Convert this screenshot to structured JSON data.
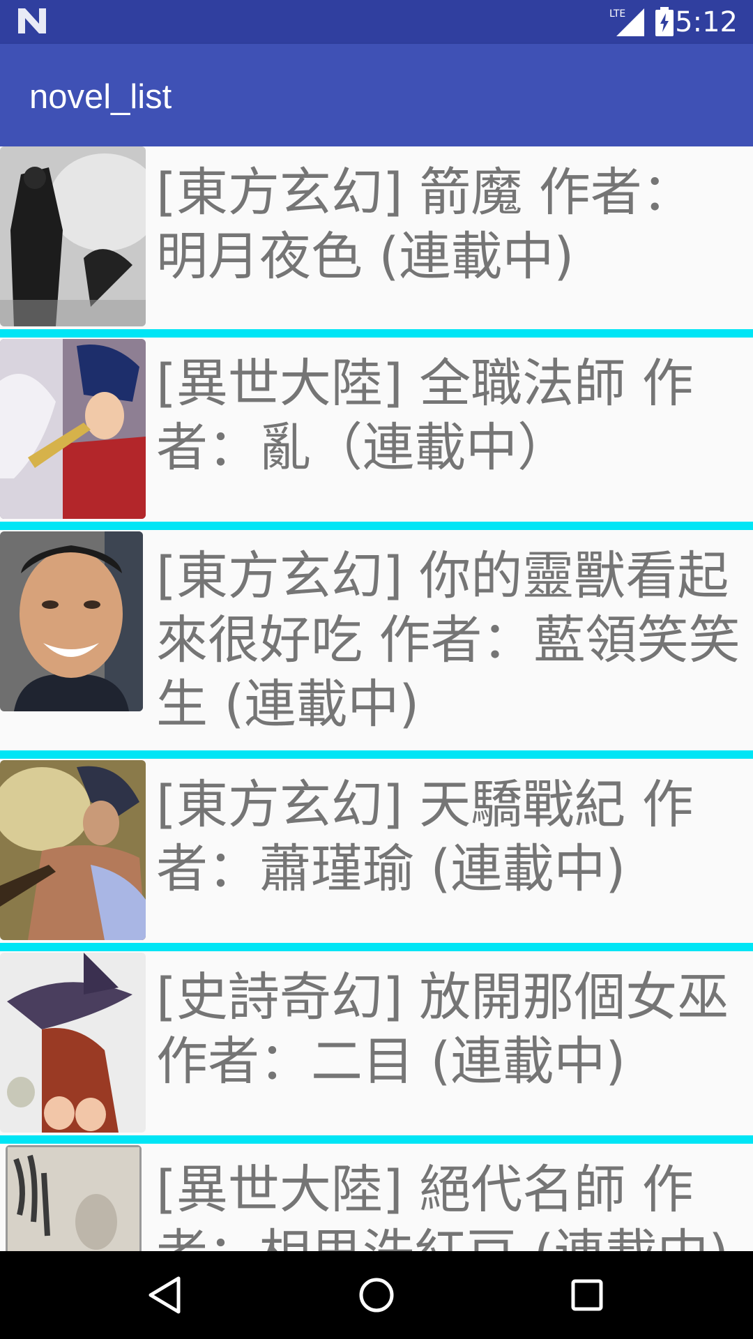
{
  "status_bar": {
    "time": "5:12",
    "network_label": "LTE",
    "icons": [
      "n-logo-icon",
      "lte-signal-icon",
      "battery-charging-icon"
    ]
  },
  "app_bar": {
    "title": "novel_list"
  },
  "novels": [
    {
      "text": "[東方玄幻] 箭魔 作者：明月夜色 (連載中)",
      "thumb": "cover-art-dark-warrior"
    },
    {
      "text": "[異世大陸] 全職法師 作者：亂（連載中）",
      "thumb": "cover-art-anime-mages"
    },
    {
      "text": "[東方玄幻] 你的靈獸看起來很好吃 作者：藍領笑笑生 (連載中)",
      "thumb": "author-portrait-photo"
    },
    {
      "text": "[東方玄幻] 天驕戰紀 作者：蕭瑾瑜 (連載中)",
      "thumb": "cover-art-warrior"
    },
    {
      "text": "[史詩奇幻] 放開那個女巫 作者：二目 (連載中)",
      "thumb": "cover-art-witch"
    },
    {
      "text": "[異世大陸] 絕代名師 作者：相思洗紅豆 (連載中)",
      "thumb": "cover-art-calligraphy"
    }
  ],
  "nav_bar": {
    "icons": [
      "back-triangle-icon",
      "home-circle-icon",
      "recents-square-icon"
    ]
  },
  "colors": {
    "status_bar": "#303f9f",
    "app_bar": "#3f51b5",
    "separator": "#00e5f5",
    "list_text": "#757575",
    "background": "#fafafa"
  }
}
